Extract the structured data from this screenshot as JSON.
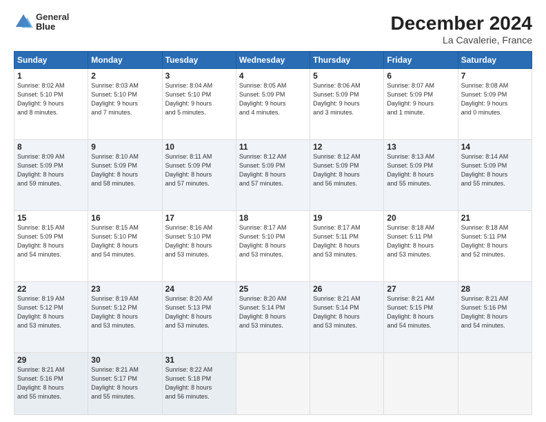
{
  "header": {
    "logo_line1": "General",
    "logo_line2": "Blue",
    "title": "December 2024",
    "subtitle": "La Cavalerie, France"
  },
  "days_of_week": [
    "Sunday",
    "Monday",
    "Tuesday",
    "Wednesday",
    "Thursday",
    "Friday",
    "Saturday"
  ],
  "weeks": [
    [
      {
        "day": "1",
        "info": "Sunrise: 8:02 AM\nSunset: 5:10 PM\nDaylight: 9 hours\nand 8 minutes."
      },
      {
        "day": "2",
        "info": "Sunrise: 8:03 AM\nSunset: 5:10 PM\nDaylight: 9 hours\nand 7 minutes."
      },
      {
        "day": "3",
        "info": "Sunrise: 8:04 AM\nSunset: 5:10 PM\nDaylight: 9 hours\nand 5 minutes."
      },
      {
        "day": "4",
        "info": "Sunrise: 8:05 AM\nSunset: 5:09 PM\nDaylight: 9 hours\nand 4 minutes."
      },
      {
        "day": "5",
        "info": "Sunrise: 8:06 AM\nSunset: 5:09 PM\nDaylight: 9 hours\nand 3 minutes."
      },
      {
        "day": "6",
        "info": "Sunrise: 8:07 AM\nSunset: 5:09 PM\nDaylight: 9 hours\nand 1 minute."
      },
      {
        "day": "7",
        "info": "Sunrise: 8:08 AM\nSunset: 5:09 PM\nDaylight: 9 hours\nand 0 minutes."
      }
    ],
    [
      {
        "day": "8",
        "info": "Sunrise: 8:09 AM\nSunset: 5:09 PM\nDaylight: 8 hours\nand 59 minutes."
      },
      {
        "day": "9",
        "info": "Sunrise: 8:10 AM\nSunset: 5:09 PM\nDaylight: 8 hours\nand 58 minutes."
      },
      {
        "day": "10",
        "info": "Sunrise: 8:11 AM\nSunset: 5:09 PM\nDaylight: 8 hours\nand 57 minutes."
      },
      {
        "day": "11",
        "info": "Sunrise: 8:12 AM\nSunset: 5:09 PM\nDaylight: 8 hours\nand 57 minutes."
      },
      {
        "day": "12",
        "info": "Sunrise: 8:12 AM\nSunset: 5:09 PM\nDaylight: 8 hours\nand 56 minutes."
      },
      {
        "day": "13",
        "info": "Sunrise: 8:13 AM\nSunset: 5:09 PM\nDaylight: 8 hours\nand 55 minutes."
      },
      {
        "day": "14",
        "info": "Sunrise: 8:14 AM\nSunset: 5:09 PM\nDaylight: 8 hours\nand 55 minutes."
      }
    ],
    [
      {
        "day": "15",
        "info": "Sunrise: 8:15 AM\nSunset: 5:09 PM\nDaylight: 8 hours\nand 54 minutes."
      },
      {
        "day": "16",
        "info": "Sunrise: 8:15 AM\nSunset: 5:10 PM\nDaylight: 8 hours\nand 54 minutes."
      },
      {
        "day": "17",
        "info": "Sunrise: 8:16 AM\nSunset: 5:10 PM\nDaylight: 8 hours\nand 53 minutes."
      },
      {
        "day": "18",
        "info": "Sunrise: 8:17 AM\nSunset: 5:10 PM\nDaylight: 8 hours\nand 53 minutes."
      },
      {
        "day": "19",
        "info": "Sunrise: 8:17 AM\nSunset: 5:11 PM\nDaylight: 8 hours\nand 53 minutes."
      },
      {
        "day": "20",
        "info": "Sunrise: 8:18 AM\nSunset: 5:11 PM\nDaylight: 8 hours\nand 53 minutes."
      },
      {
        "day": "21",
        "info": "Sunrise: 8:18 AM\nSunset: 5:11 PM\nDaylight: 8 hours\nand 52 minutes."
      }
    ],
    [
      {
        "day": "22",
        "info": "Sunrise: 8:19 AM\nSunset: 5:12 PM\nDaylight: 8 hours\nand 53 minutes."
      },
      {
        "day": "23",
        "info": "Sunrise: 8:19 AM\nSunset: 5:12 PM\nDaylight: 8 hours\nand 53 minutes."
      },
      {
        "day": "24",
        "info": "Sunrise: 8:20 AM\nSunset: 5:13 PM\nDaylight: 8 hours\nand 53 minutes."
      },
      {
        "day": "25",
        "info": "Sunrise: 8:20 AM\nSunset: 5:14 PM\nDaylight: 8 hours\nand 53 minutes."
      },
      {
        "day": "26",
        "info": "Sunrise: 8:21 AM\nSunset: 5:14 PM\nDaylight: 8 hours\nand 53 minutes."
      },
      {
        "day": "27",
        "info": "Sunrise: 8:21 AM\nSunset: 5:15 PM\nDaylight: 8 hours\nand 54 minutes."
      },
      {
        "day": "28",
        "info": "Sunrise: 8:21 AM\nSunset: 5:16 PM\nDaylight: 8 hours\nand 54 minutes."
      }
    ],
    [
      {
        "day": "29",
        "info": "Sunrise: 8:21 AM\nSunset: 5:16 PM\nDaylight: 8 hours\nand 55 minutes."
      },
      {
        "day": "30",
        "info": "Sunrise: 8:21 AM\nSunset: 5:17 PM\nDaylight: 8 hours\nand 55 minutes."
      },
      {
        "day": "31",
        "info": "Sunrise: 8:22 AM\nSunset: 5:18 PM\nDaylight: 8 hours\nand 56 minutes."
      },
      {
        "day": "",
        "info": ""
      },
      {
        "day": "",
        "info": ""
      },
      {
        "day": "",
        "info": ""
      },
      {
        "day": "",
        "info": ""
      }
    ]
  ]
}
